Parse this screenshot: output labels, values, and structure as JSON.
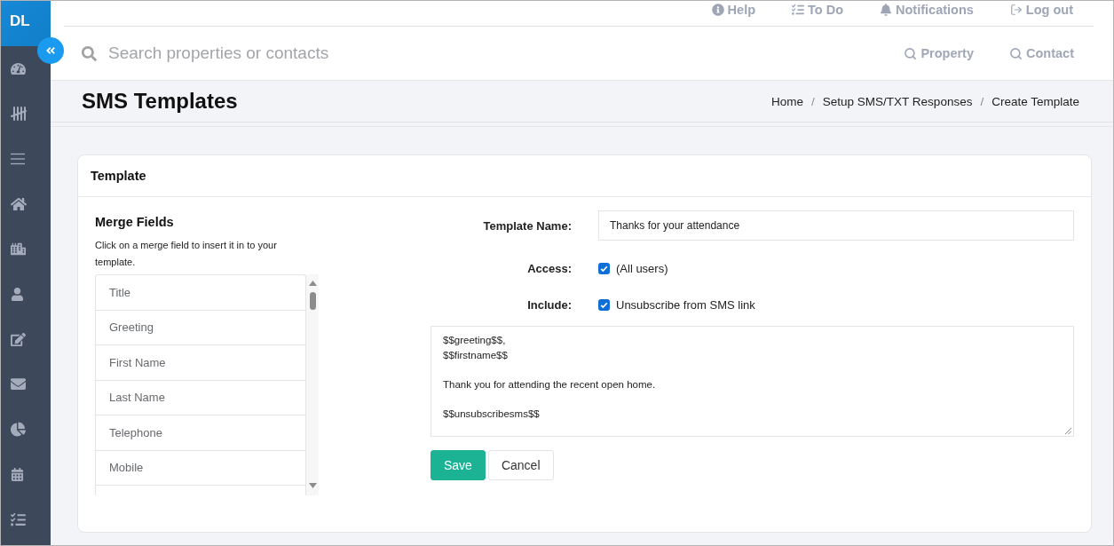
{
  "sidebar": {
    "logo": "DL"
  },
  "top_links": [
    {
      "label": "Help"
    },
    {
      "label": "To Do"
    },
    {
      "label": "Notifications"
    },
    {
      "label": "Log out"
    }
  ],
  "search": {
    "placeholder": "Search properties or contacts",
    "scopes": [
      {
        "label": "Property"
      },
      {
        "label": "Contact"
      }
    ]
  },
  "page_header": {
    "title": "SMS Templates",
    "breadcrumb": [
      {
        "label": "Home"
      },
      {
        "label": "Setup SMS/TXT Responses",
        "separator": "/"
      },
      {
        "label": "Create Template",
        "separator": "/"
      }
    ]
  },
  "card": {
    "title": "Template",
    "merge_fields": {
      "title": "Merge Fields",
      "hint": "Click on a merge field to insert it in to your template.",
      "items": [
        {
          "label": "Title"
        },
        {
          "label": "Greeting"
        },
        {
          "label": "First Name"
        },
        {
          "label": "Last Name"
        },
        {
          "label": "Telephone"
        },
        {
          "label": "Mobile"
        }
      ]
    },
    "form": {
      "template_name": {
        "label": "Template Name:",
        "value": "Thanks for your attendance"
      },
      "options": [
        {
          "label": "Access:",
          "text": "(All users)",
          "checked": true
        },
        {
          "label": "Include:",
          "text": "Unsubscribe from SMS link",
          "checked": true
        }
      ],
      "message": "$$greeting$$,\n$$firstname$$\n\nThank you for attending the recent open home.\n\n$$unsubscribesms$$",
      "buttons": [
        {
          "label": "Save",
          "kind": "primary"
        },
        {
          "label": "Cancel",
          "kind": "default"
        }
      ]
    }
  }
}
